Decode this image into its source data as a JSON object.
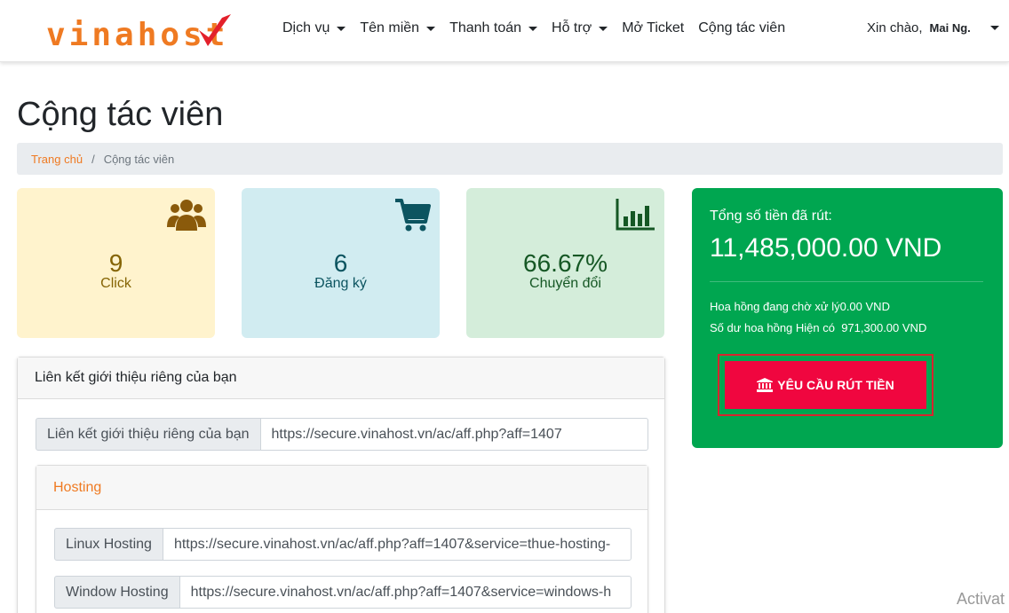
{
  "nav": {
    "brand": "vinahost",
    "items": [
      {
        "label": "Dịch vụ"
      },
      {
        "label": "Tên miền"
      },
      {
        "label": "Thanh toán"
      },
      {
        "label": "Hỗ trợ"
      },
      {
        "label": "Mở Ticket"
      },
      {
        "label": "Cộng tác viên"
      }
    ],
    "greeting": "Xin chào,",
    "user_name": "Mai Ng."
  },
  "page": {
    "title": "Cộng tác viên",
    "breadcrumb": {
      "home": "Trang chủ",
      "separator": "/",
      "current": "Cộng tác viên"
    }
  },
  "stats": [
    {
      "value": "9",
      "label": "Click",
      "icon": "users-icon"
    },
    {
      "value": "6",
      "label": "Đăng ký",
      "icon": "shopping-cart-icon"
    },
    {
      "value": "66.67%",
      "label": "Chuyển đổi",
      "icon": "bar-chart-icon"
    }
  ],
  "payout": {
    "title": "Tổng số tiền đã rút:",
    "amount": "11,485,000.00 VND",
    "pending_label": "Hoa hồng đang chờ xử lý",
    "pending_value": "0.00 VND",
    "balance_label": "Số dư hoa hồng Hiện có",
    "balance_value": "971,300.00 VND",
    "button": "YÊU CẦU RÚT TIỀN"
  },
  "referral": {
    "heading": "Liên kết giới thiệu riêng của bạn",
    "main_label": "Liên kết giới thiệu riêng của bạn",
    "main_url": "https://secure.vinahost.vn/ac/aff.php?aff=1407",
    "hosting": {
      "heading": "Hosting",
      "links": [
        {
          "label": "Linux Hosting",
          "url": "https://secure.vinahost.vn/ac/aff.php?aff=1407&service=thue-hosting-"
        },
        {
          "label": "Window Hosting",
          "url": "https://secure.vinahost.vn/ac/aff.php?aff=1407&service=windows-h"
        }
      ]
    }
  },
  "colors": {
    "brand_orange": "#ef7a22",
    "green": "#00a650",
    "red_button": "#f0063f",
    "red_outline": "#d9232e"
  },
  "overlay": {
    "watermark": "Activat"
  }
}
